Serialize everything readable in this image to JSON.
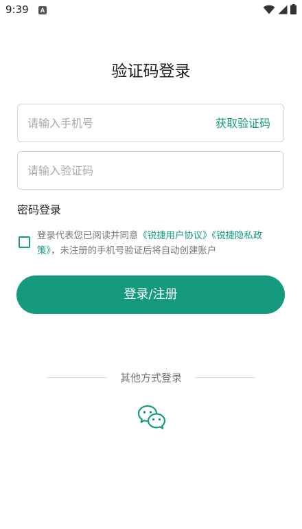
{
  "status_bar": {
    "time": "9:39",
    "notification_badge": "A",
    "icons": [
      "wifi-icon",
      "cellular-signal-icon",
      "battery-icon"
    ]
  },
  "title": "验证码登录",
  "phone_input": {
    "placeholder": "请输入手机号",
    "value": ""
  },
  "get_code_label": "获取验证码",
  "code_input": {
    "placeholder": "请输入验证码",
    "value": ""
  },
  "password_login_label": "密码登录",
  "agreement": {
    "checked": false,
    "prefix": "登录代表您已阅读并同意",
    "user_agreement": "《锐捷用户协议》",
    "privacy_policy": "《锐捷隐私政策》",
    "suffix": "，未注册的手机号验证后将自动创建账户"
  },
  "submit_label": "登录/注册",
  "other_login_label": "其他方式登录",
  "other_login_icons": [
    "wechat-icon"
  ],
  "colors": {
    "accent": "#169a7f",
    "link": "#159a7f",
    "border": "#d3d3d3"
  }
}
